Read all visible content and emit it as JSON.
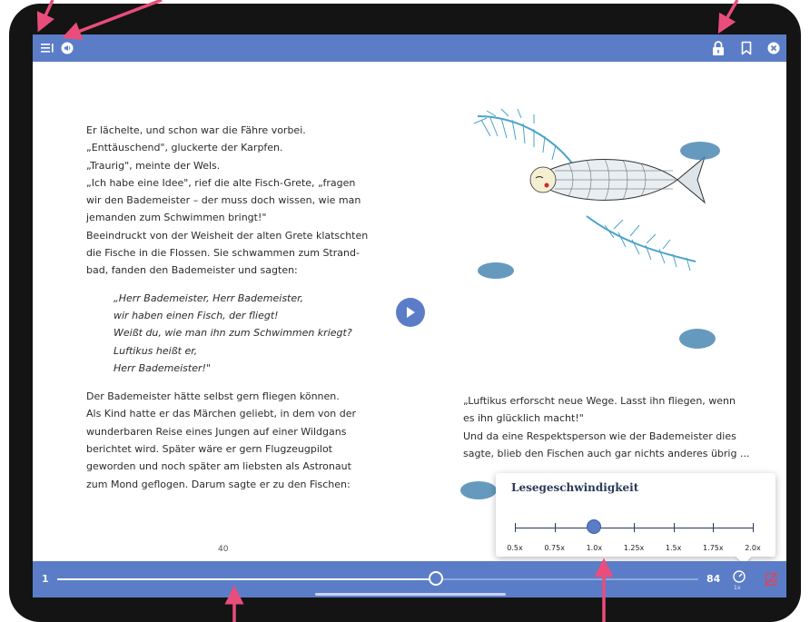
{
  "topbar": {
    "icons": [
      "menu-icon",
      "audio-icon",
      "lock-icon",
      "bookmark-icon",
      "close-icon"
    ]
  },
  "left_page": {
    "paragraph1": "Er lächelte, und schon war die Fähre vorbei.\n„Enttäuschend\", gluckerte der Karpfen.\n„Traurig\", meinte der Wels.\n„Ich habe eine Idee\", rief die alte Fisch-Grete, „fragen\nwir den Bademeister – der muss doch wissen, wie man\njemanden zum Schwimmen bringt!\"\nBeeindruckt von der Weisheit der alten Grete klatschten\ndie Fische in die Flossen. Sie schwammen zum Strand-\nbad, fanden den Bademeister und sagten:",
    "verse": "„Herr Bademeister, Herr Bademeister,\nwir haben einen Fisch, der fliegt!\nWeißt du, wie man ihn zum Schwimmen kriegt?\nLuftikus heißt er,\nHerr Bademeister!\"",
    "paragraph2": "Der Bademeister hätte selbst gern fliegen können.\nAls Kind hatte er das Märchen geliebt, in dem von der\nwunderbaren Reise eines Jungen auf einer Wildgans\nberichtet wird. Später wäre er gern Flugzeugpilot\ngeworden und noch später am liebsten als Astronaut\nzum Mond geflogen. Darum sagte er zu den Fischen:",
    "page_number": "40"
  },
  "right_page": {
    "text": "„Luftikus erforscht neue Wege. Lasst ihn fliegen, wenn\nes ihn glücklich macht!\"\nUnd da eine Respektsperson wie der Bademeister dies\nsagte, blieb den Fischen auch gar nichts anderes übrig ..."
  },
  "play_button": {
    "icon": "play-icon"
  },
  "bottombar": {
    "start_page": "1",
    "end_page": "84",
    "progress": 0.59,
    "speed_badge": "1x",
    "icons": [
      "speed-icon",
      "no-image-icon"
    ]
  },
  "speed_popup": {
    "title": "Lesegeschwindigkeit",
    "options": [
      "0.5x",
      "0.75x",
      "1.0x",
      "1.25x",
      "1.5x",
      "1.75x",
      "2.0x"
    ],
    "selected": "1.0x",
    "selected_index": 2
  },
  "colors": {
    "bar": "#5b7dc8",
    "annotation_arrow": "#e94d7b",
    "speed_text": "#2a3a5a"
  }
}
